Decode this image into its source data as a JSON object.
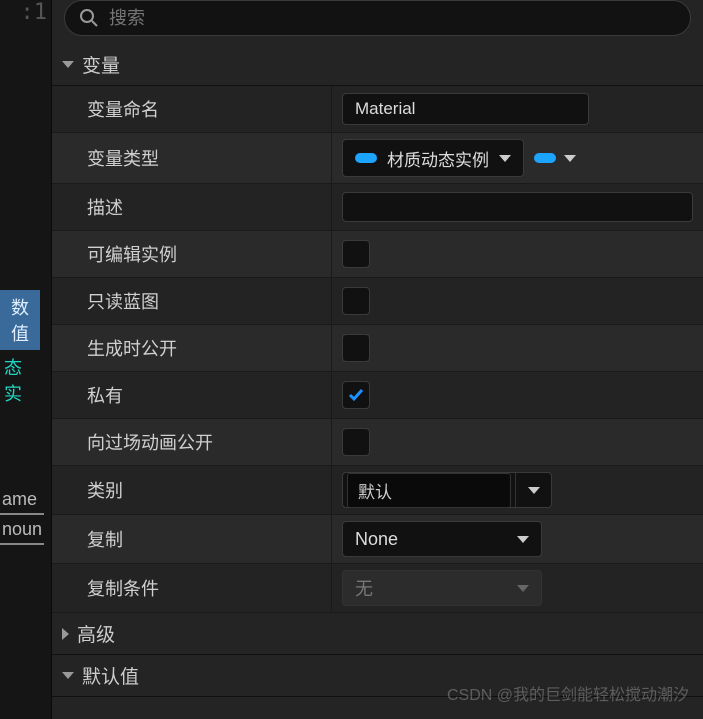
{
  "search": {
    "placeholder": "搜索"
  },
  "left": {
    "top": ":1",
    "tag1": "数值",
    "tag2": "态实",
    "b1": "ame",
    "b2": "noun"
  },
  "sections": {
    "variables": {
      "title": "变量"
    },
    "advanced": {
      "title": "高级"
    },
    "default": {
      "title": "默认值"
    }
  },
  "rows": {
    "name": {
      "label": "变量命名",
      "value": "Material"
    },
    "type": {
      "label": "变量类型",
      "value": "材质动态实例"
    },
    "desc": {
      "label": "描述",
      "value": ""
    },
    "editable": {
      "label": "可编辑实例",
      "checked": false
    },
    "readonlyBp": {
      "label": "只读蓝图",
      "checked": false
    },
    "exposeSpawn": {
      "label": "生成时公开",
      "checked": false
    },
    "private": {
      "label": "私有",
      "checked": true
    },
    "exposeCine": {
      "label": "向过场动画公开",
      "checked": false
    },
    "category": {
      "label": "类别",
      "value": "默认"
    },
    "replicate": {
      "label": "复制",
      "value": "None"
    },
    "repCond": {
      "label": "复制条件",
      "value": "无"
    }
  },
  "watermark": "CSDN @我的巨剑能轻松搅动潮汐"
}
